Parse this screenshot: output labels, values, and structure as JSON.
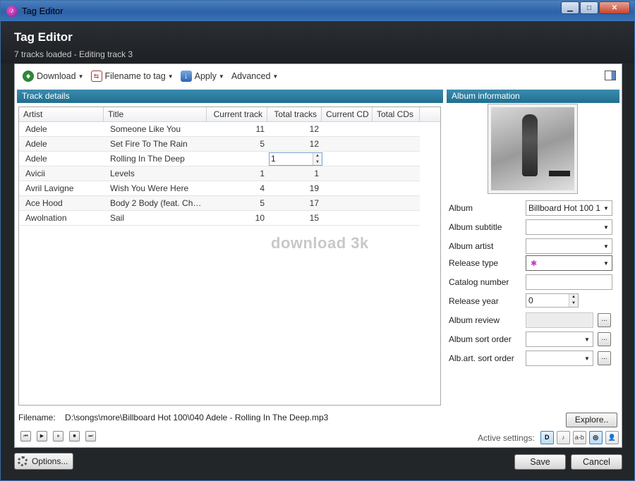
{
  "window": {
    "title": "Tag Editor",
    "controls": {
      "minimize": "▁",
      "maximize": "□",
      "close": "✕"
    }
  },
  "header": {
    "title": "Tag Editor",
    "subtitle": "7 tracks loaded - Editing track 3"
  },
  "toolbar": {
    "download_label": "Download",
    "filename_to_tag_label": "Filename to tag",
    "apply_label": "Apply",
    "advanced_label": "Advanced"
  },
  "track_details": {
    "heading": "Track details",
    "columns": [
      "Artist",
      "Title",
      "Current track",
      "Total tracks",
      "Current CD",
      "Total CDs"
    ],
    "rows": [
      {
        "artist": "Adele",
        "title": "Someone Like You",
        "current_track": "11",
        "total_tracks": "12",
        "current_cd": "",
        "total_cds": ""
      },
      {
        "artist": "Adele",
        "title": "Set Fire To The Rain",
        "current_track": "5",
        "total_tracks": "12",
        "current_cd": "",
        "total_cds": ""
      },
      {
        "artist": "Adele",
        "title": "Rolling In The Deep",
        "current_track": "",
        "total_tracks": "1",
        "current_cd": "",
        "total_cds": ""
      },
      {
        "artist": "Avicii",
        "title": "Levels",
        "current_track": "1",
        "total_tracks": "1",
        "current_cd": "",
        "total_cds": ""
      },
      {
        "artist": "Avril Lavigne",
        "title": "Wish You Were Here",
        "current_track": "4",
        "total_tracks": "19",
        "current_cd": "",
        "total_cds": ""
      },
      {
        "artist": "Ace Hood",
        "title": "Body 2 Body (feat. Chris...",
        "current_track": "5",
        "total_tracks": "17",
        "current_cd": "",
        "total_cds": ""
      },
      {
        "artist": "Awolnation",
        "title": "Sail",
        "current_track": "10",
        "total_tracks": "15",
        "current_cd": "",
        "total_cds": ""
      }
    ],
    "watermark": "download 3k"
  },
  "album_info": {
    "heading": "Album information",
    "fields": {
      "album_label": "Album",
      "album_value": "Billboard Hot 100 1",
      "subtitle_label": "Album subtitle",
      "subtitle_value": "",
      "artist_label": "Album artist",
      "artist_value": "",
      "release_type_label": "Release type",
      "catalog_label": "Catalog number",
      "catalog_value": "",
      "year_label": "Release year",
      "year_value": "0",
      "review_label": "Album review",
      "sort_order_label": "Album sort order",
      "artist_sort_order_label": "Alb.art. sort order",
      "browse_label": "..."
    }
  },
  "footer": {
    "filename_label": "Filename:",
    "filename_value": "D:\\songs\\more\\Billboard Hot 100\\040 Adele - Rolling In The Deep.mp3",
    "explore_label": "Explore..",
    "player": [
      "⏮",
      "▶",
      "⏸",
      "■",
      "⏭"
    ],
    "active_settings_label": "Active settings:",
    "settings_glyphs": [
      "D",
      "♪",
      "a-b",
      "◎",
      "👤"
    ]
  },
  "buttons": {
    "options": "Options...",
    "save": "Save",
    "cancel": "Cancel"
  }
}
